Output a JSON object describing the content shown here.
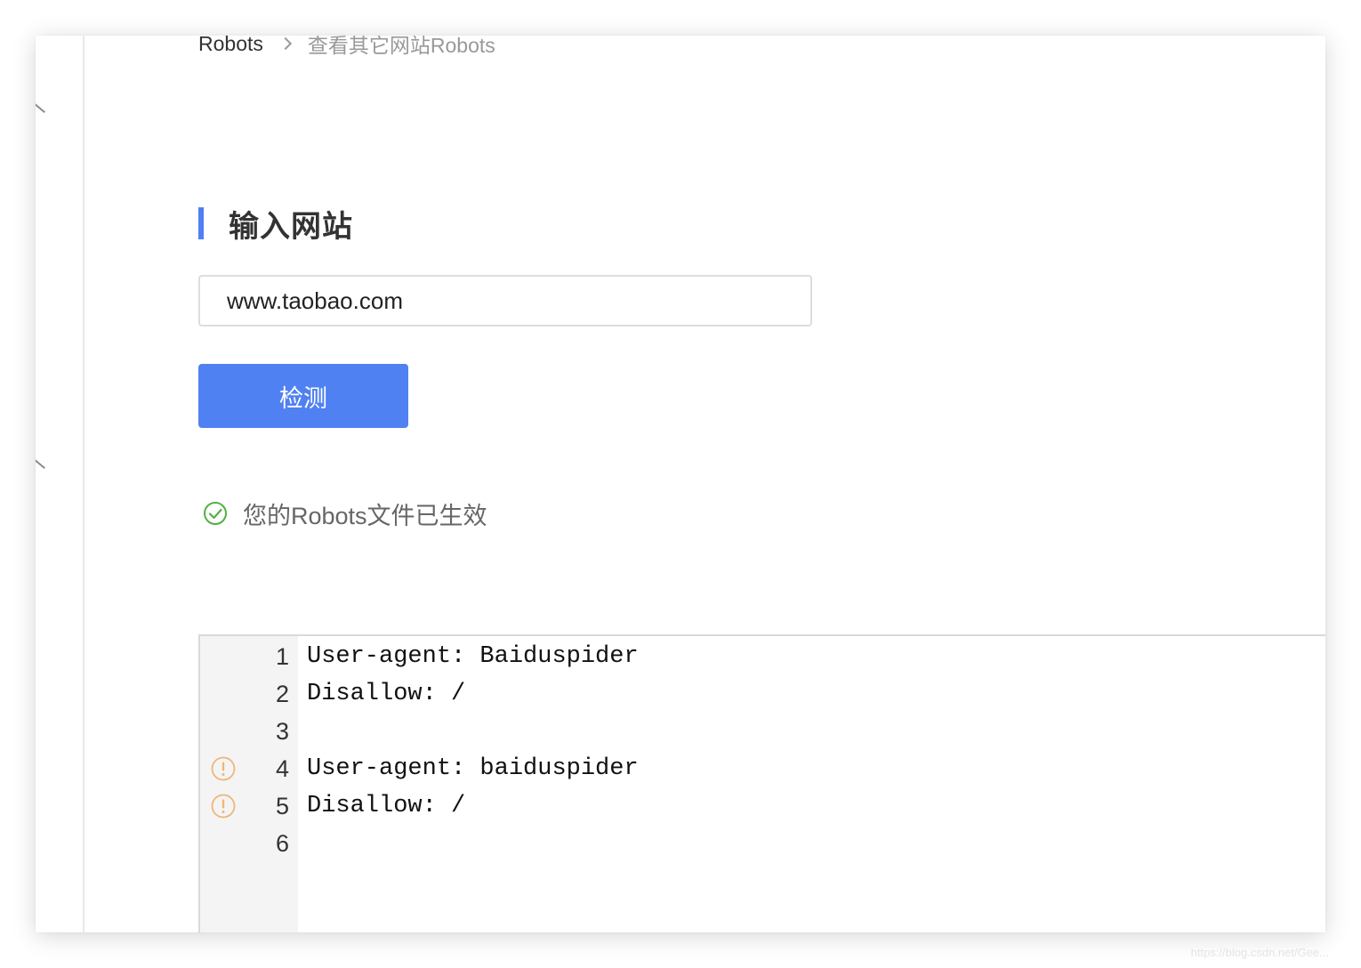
{
  "breadcrumb": {
    "root": "Robots",
    "current": "查看其它网站Robots"
  },
  "section": {
    "title": "输入网站"
  },
  "search": {
    "value": "www.taobao.com"
  },
  "actions": {
    "check_label": "检测"
  },
  "status": {
    "icon": "check-circle-icon",
    "text": "您的Robots文件已生效",
    "color": "#52b043"
  },
  "editor": {
    "warning_color": "#f0b57a",
    "lines": [
      {
        "number": "1",
        "text": "User-agent: Baiduspider",
        "warning": false
      },
      {
        "number": "2",
        "text": "Disallow: /",
        "warning": false
      },
      {
        "number": "3",
        "text": "",
        "warning": false
      },
      {
        "number": "4",
        "text": "User-agent: baiduspider",
        "warning": true
      },
      {
        "number": "5",
        "text": "Disallow: /",
        "warning": true
      },
      {
        "number": "6",
        "text": "",
        "warning": false
      }
    ]
  },
  "watermark": "https://blog.csdn.net/Gee...",
  "theme": {
    "accent": "#4f7ff2"
  }
}
